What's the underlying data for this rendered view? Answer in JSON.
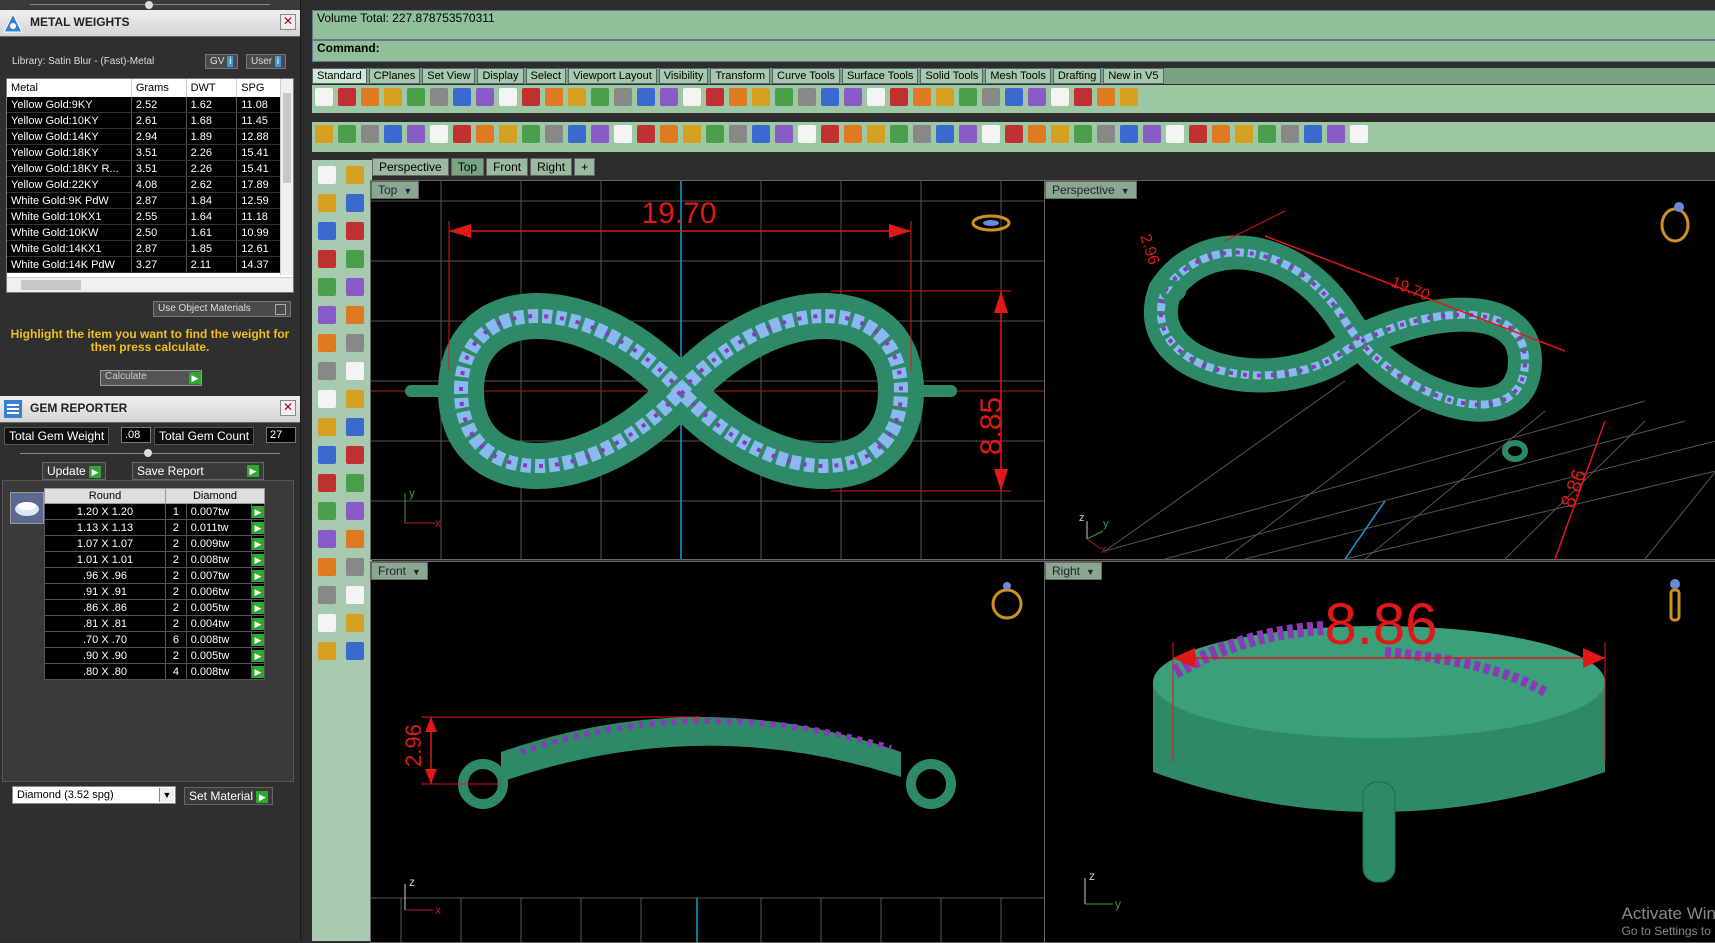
{
  "metal_weights": {
    "title": "METAL WEIGHTS",
    "library": "Library: Satin Blur - (Fast)-Metal",
    "gv_label": "GV",
    "user_label": "User",
    "columns": [
      "Metal",
      "Grams",
      "DWT",
      "SPG"
    ],
    "rows": [
      [
        "Yellow Gold:9KY",
        "2.52",
        "1.62",
        "11.08"
      ],
      [
        "Yellow Gold:10KY",
        "2.61",
        "1.68",
        "11.45"
      ],
      [
        "Yellow Gold:14KY",
        "2.94",
        "1.89",
        "12.88"
      ],
      [
        "Yellow Gold:18KY",
        "3.51",
        "2.26",
        "15.41"
      ],
      [
        "Yellow Gold:18KY R...",
        "3.51",
        "2.26",
        "15.41"
      ],
      [
        "Yellow Gold:22KY",
        "4.08",
        "2.62",
        "17.89"
      ],
      [
        "White Gold:9K PdW",
        "2.87",
        "1.84",
        "12.59"
      ],
      [
        "White Gold:10KX1",
        "2.55",
        "1.64",
        "11.18"
      ],
      [
        "White Gold:10KW",
        "2.50",
        "1.61",
        "10.99"
      ],
      [
        "White Gold:14KX1",
        "2.87",
        "1.85",
        "12.61"
      ],
      [
        "White Gold:14K PdW",
        "3.27",
        "2.11",
        "14.37"
      ]
    ],
    "use_object_materials": "Use Object Materials",
    "hint": "Highlight the item you want to find the weight for then press calculate.",
    "calculate_label": "Calculate"
  },
  "gem_reporter": {
    "title": "GEM REPORTER",
    "total_weight_label": "Total Gem Weight",
    "total_weight_value": ".08",
    "total_count_label": "Total Gem Count",
    "total_count_value": "27",
    "update_label": "Update",
    "save_report_label": "Save Report",
    "columns": [
      "Round",
      "Diamond"
    ],
    "rows": [
      [
        "1.20 X 1.20",
        "1",
        "0.007tw"
      ],
      [
        "1.13 X 1.13",
        "2",
        "0.011tw"
      ],
      [
        "1.07 X 1.07",
        "2",
        "0.009tw"
      ],
      [
        "1.01 X 1.01",
        "2",
        "0.008tw"
      ],
      [
        ".96 X .96",
        "2",
        "0.007tw"
      ],
      [
        ".91 X .91",
        "2",
        "0.006tw"
      ],
      [
        ".86 X .86",
        "2",
        "0.005tw"
      ],
      [
        ".81 X .81",
        "2",
        "0.004tw"
      ],
      [
        ".70 X .70",
        "6",
        "0.008tw"
      ],
      [
        ".90 X .90",
        "2",
        "0.005tw"
      ],
      [
        ".80 X .80",
        "4",
        "0.008tw"
      ]
    ],
    "material_select": "Diamond     (3.52 spg)",
    "set_material_label": "Set Material"
  },
  "rhino": {
    "volume_total": "Volume Total: 227.878753570311",
    "command_label": "Command:",
    "tabs": [
      "Standard",
      "CPlanes",
      "Set View",
      "Display",
      "Select",
      "Viewport Layout",
      "Visibility",
      "Transform",
      "Curve Tools",
      "Surface Tools",
      "Solid Tools",
      "Mesh Tools",
      "Drafting",
      "New in V5"
    ],
    "viewport_tabs": [
      "Perspective",
      "Top",
      "Front",
      "Right",
      "+"
    ],
    "viewports": {
      "top": {
        "label": "Top",
        "dim_width": "19.70",
        "dim_height": "8.85"
      },
      "perspective": {
        "label": "Perspective",
        "dim_a": "2.96",
        "dim_b": "19.70",
        "dim_c": "8.86"
      },
      "front": {
        "label": "Front",
        "dim_height": "2.96"
      },
      "right": {
        "label": "Right",
        "dim_width": "8.86"
      }
    },
    "axis": {
      "x": "x",
      "y": "y",
      "z": "z"
    },
    "watermark_line1": "Activate Win",
    "watermark_line2": "Go to Settings to"
  },
  "colors": {
    "accent_green": "#8fc09a",
    "dimension_red": "#e01818",
    "ring_green": "#2e8a66",
    "gem_blue": "#8ab8f0",
    "gem_purple": "#8a3ab8",
    "hint_yellow": "#f0c020"
  }
}
